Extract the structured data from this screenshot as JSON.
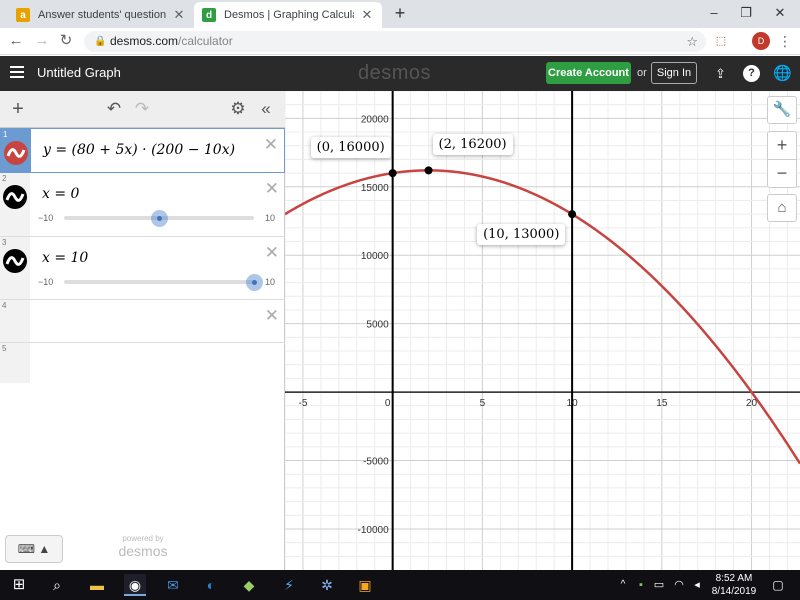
{
  "browser": {
    "tabs": [
      {
        "title": "Answer students' questions and I",
        "active": false
      },
      {
        "title": "Desmos | Graphing Calculator",
        "active": true
      }
    ],
    "new_tab_glyph": "+",
    "url_host": "desmos.com",
    "url_path": "/calculator",
    "profile_initial": "D"
  },
  "desmos": {
    "graph_title": "Untitled Graph",
    "logo_text": "desmos",
    "create_account_label": "Create Account",
    "or_text": "or",
    "sign_in_label": "Sign In",
    "powered_by": "powered by",
    "powered_logo": "desmos"
  },
  "expressions": [
    {
      "num": "1",
      "text": "y = (80 + 5x) · (200 − 10x)",
      "color": "#c74440",
      "kind": "expression"
    },
    {
      "num": "2",
      "text": "x = 0",
      "color": "#000000",
      "kind": "slider",
      "min_label": "−10",
      "max_label": "10",
      "value": 0,
      "min": -10,
      "max": 10
    },
    {
      "num": "3",
      "text": "x = 10",
      "color": "#000000",
      "kind": "slider",
      "min_label": "−10",
      "max_label": "10",
      "value": 10,
      "min": -10,
      "max": 10
    },
    {
      "num": "4",
      "text": "",
      "kind": "empty"
    },
    {
      "num": "5",
      "text": "",
      "kind": "empty"
    }
  ],
  "chart_data": {
    "type": "line",
    "title": "",
    "xlim": [
      -6,
      22.7
    ],
    "ylim": [
      -13000,
      22000
    ],
    "x_ticks": [
      -5,
      0,
      5,
      10,
      15,
      20
    ],
    "x_tick_labels": [
      "-5",
      "0",
      "5",
      "10",
      "15",
      "20"
    ],
    "y_ticks": [
      -10000,
      -5000,
      5000,
      10000,
      15000,
      20000
    ],
    "y_tick_labels": [
      "-10000",
      "-5000",
      "5000",
      "10000",
      "15000",
      "20000"
    ],
    "grid": true,
    "series": [
      {
        "formula": "(80 + 5x)(200 - 10x)",
        "color": "#c74440"
      }
    ],
    "vertical_lines": [
      0,
      10
    ],
    "points": [
      {
        "x": 0,
        "y": 16000,
        "label": "(0, 16000)"
      },
      {
        "x": 2,
        "y": 16200,
        "label": "(2, 16200)"
      },
      {
        "x": 10,
        "y": 13000,
        "label": "(10, 13000)"
      }
    ]
  },
  "taskbar": {
    "time": "8:52 AM",
    "date": "8/14/2019"
  }
}
